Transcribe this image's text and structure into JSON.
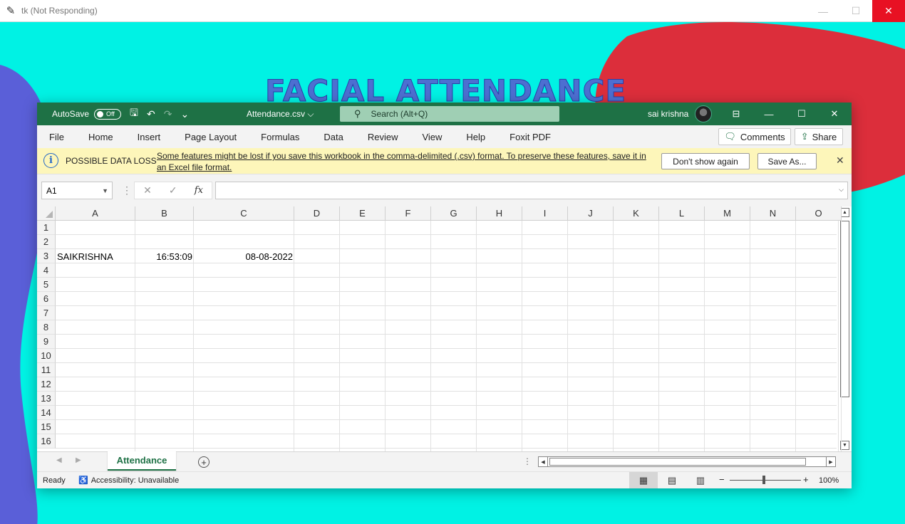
{
  "outer_window": {
    "title": "tk (Not Responding)",
    "controls": {
      "minimize": "—",
      "maximize": "☐",
      "close": "✕"
    }
  },
  "app_heading": "FACIAL ATTENDANCE",
  "excel": {
    "titlebar": {
      "autosave_label": "AutoSave",
      "autosave_state": "Off",
      "filename": "Attendance.csv",
      "filename_chevron": "⌵",
      "search_placeholder": "Search (Alt+Q)",
      "user_name": "sai krishna",
      "window_controls": {
        "ribbon_display": "⊟",
        "minimize": "—",
        "restore": "☐",
        "close": "✕"
      }
    },
    "menu": {
      "items": [
        "File",
        "Home",
        "Insert",
        "Page Layout",
        "Formulas",
        "Data",
        "Review",
        "View",
        "Help",
        "Foxit PDF"
      ],
      "comments_label": "Comments",
      "share_label": "Share"
    },
    "warning": {
      "icon": "i",
      "title": "POSSIBLE DATA LOSS",
      "message": "Some features might be lost if you save this workbook in the comma-delimited (.csv) format. To preserve these features, save it in an Excel file format.",
      "dont_show_label": "Don't show again",
      "save_as_label": "Save As...",
      "close": "✕"
    },
    "formula_bar": {
      "name_box": "A1",
      "cancel_glyph": "✕",
      "enter_glyph": "✓",
      "fx": "fx",
      "formula": ""
    },
    "columns": [
      "A",
      "B",
      "C",
      "D",
      "E",
      "F",
      "G",
      "H",
      "I",
      "J",
      "K",
      "L",
      "M",
      "N",
      "O"
    ],
    "rows": [
      "1",
      "2",
      "3",
      "4",
      "5",
      "6",
      "7",
      "8",
      "9",
      "10",
      "11",
      "12",
      "13",
      "14",
      "15",
      "16"
    ],
    "cells": {
      "A3": "SAIKRISHNA",
      "B3": "16:53:09",
      "C3": "08-08-2022"
    },
    "sheet_tab": "Attendance",
    "status": {
      "ready": "Ready",
      "accessibility": "Accessibility: Unavailable",
      "zoom": "100%"
    }
  }
}
